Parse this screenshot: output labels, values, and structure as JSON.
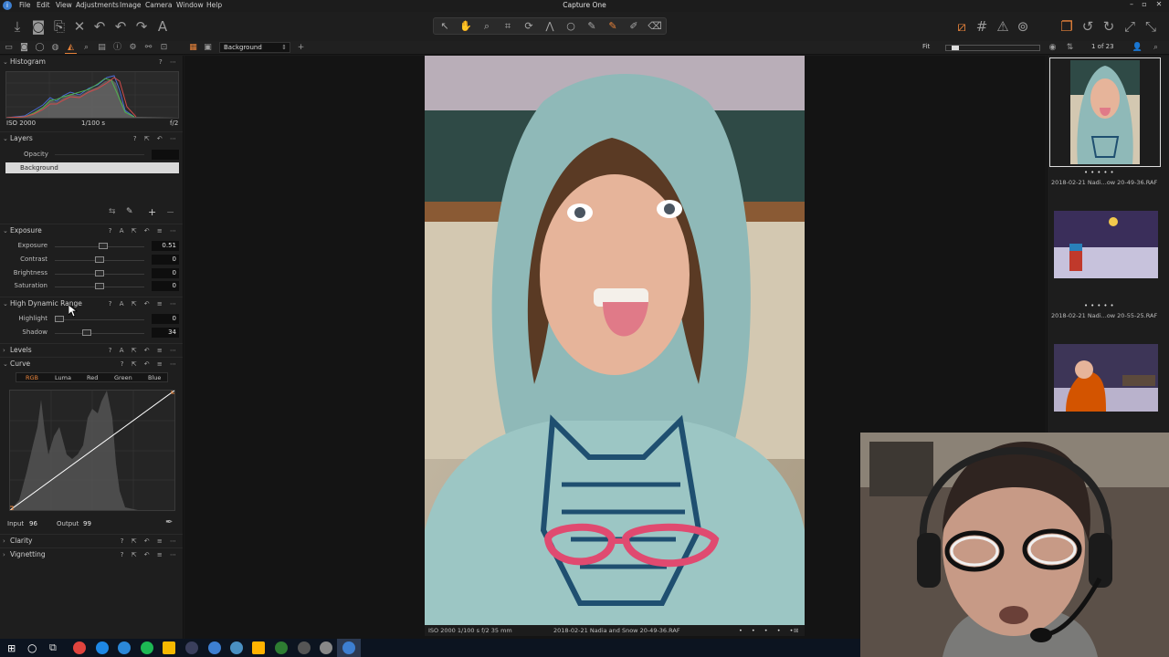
{
  "app": {
    "title": "Capture One",
    "menu": [
      "File",
      "Edit",
      "View",
      "Adjustments",
      "Image",
      "Camera",
      "Window",
      "Help"
    ]
  },
  "tool_tabs": {
    "variant_name": "Background",
    "zoom_label": "Fit",
    "counter": "1 of 23"
  },
  "histogram": {
    "title": "Histogram",
    "iso": "ISO 2000",
    "shutter": "1/100 s",
    "aperture": "f/2"
  },
  "layers": {
    "title": "Layers",
    "opacity_label": "Opacity",
    "background_layer": "Background"
  },
  "exposure": {
    "title": "Exposure",
    "sliders": [
      {
        "label": "Exposure",
        "value": "0.51",
        "pos": 0.55
      },
      {
        "label": "Contrast",
        "value": "0",
        "pos": 0.5
      },
      {
        "label": "Brightness",
        "value": "0",
        "pos": 0.5
      },
      {
        "label": "Saturation",
        "value": "0",
        "pos": 0.5
      }
    ]
  },
  "hdr": {
    "title": "High Dynamic Range",
    "sliders": [
      {
        "label": "Highlight",
        "value": "0",
        "pos": 0.0
      },
      {
        "label": "Shadow",
        "value": "34",
        "pos": 0.34
      }
    ]
  },
  "levels": {
    "title": "Levels"
  },
  "curve": {
    "title": "Curve",
    "tabs": [
      "RGB",
      "Luma",
      "Red",
      "Green",
      "Blue"
    ],
    "active_tab": "RGB",
    "input_label": "Input",
    "input_value": "96",
    "output_label": "Output",
    "output_value": "99"
  },
  "clarity": {
    "title": "Clarity"
  },
  "vignetting": {
    "title": "Vignetting"
  },
  "viewer": {
    "photo_meta": "ISO 2000  1/100 s  f/2  35 mm",
    "photo_filename": "2018-02-21 Nadia and Snow 20-49-36.RAF"
  },
  "browser": {
    "thumbs": [
      {
        "name": "2018-02-21 Nadi...ow 20-49-36.RAF"
      },
      {
        "name": "2018-02-21 Nadi...ow 20-55-25.RAF"
      }
    ]
  },
  "colors": {
    "accent": "#e8833a",
    "panel_bg": "#1e1e1e",
    "viewer_bg": "#141414"
  }
}
